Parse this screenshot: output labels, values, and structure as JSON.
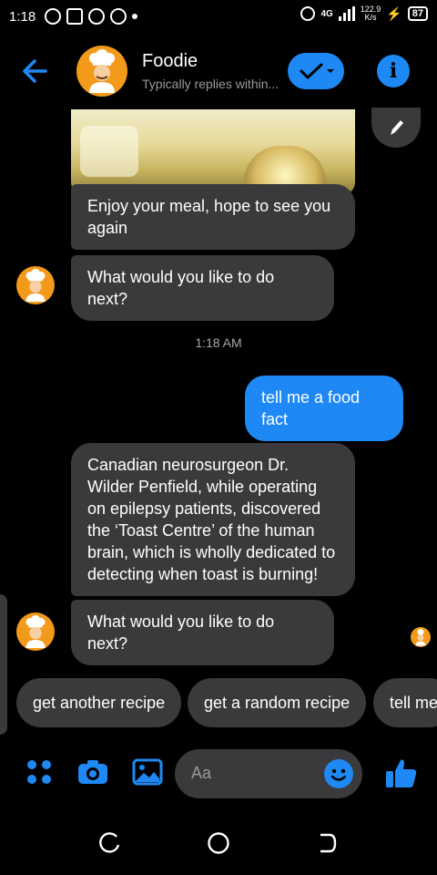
{
  "status_bar": {
    "time": "1:18",
    "network": "4G",
    "speed_value": "122.9",
    "speed_unit": "K/s",
    "battery": "87"
  },
  "header": {
    "title": "Foodie",
    "subtitle": "Typically replies within...",
    "icons": {
      "back": "arrow-left-icon",
      "check": "check-dropdown-icon",
      "info": "info-icon"
    }
  },
  "messages": {
    "msg1": "Enjoy your meal, hope to see you again",
    "msg2": "What would you like to do next?",
    "timestamp": "1:18 AM",
    "msg_out": "tell me a food fact",
    "msg3": "Canadian neurosurgeon Dr. Wilder Penfield, while operating on epilepsy patients, discovered the ‘Toast Centre’ of the human brain, which is wholly dedicated to detecting when toast is burning!",
    "msg4": "What would you like to do next?"
  },
  "quick_replies": [
    "get another recipe",
    "get a random recipe",
    "tell me"
  ],
  "composer": {
    "placeholder": "Aa",
    "icons": [
      "apps-icon",
      "camera-icon",
      "gallery-icon",
      "emoji-icon",
      "thumbs-up-icon"
    ]
  },
  "colors": {
    "accent": "#1e88f5",
    "bubble": "#3a3a3c",
    "avatar_bg": "#f39a1b",
    "background": "#000000"
  }
}
